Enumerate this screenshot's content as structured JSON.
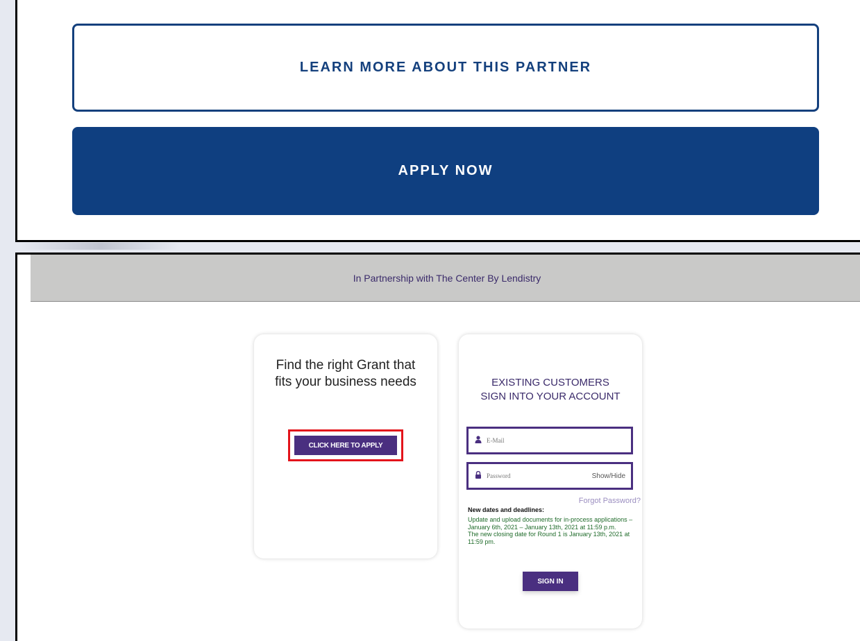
{
  "partner_panel": {
    "learn_more_label": "LEARN MORE ABOUT THIS PARTNER",
    "apply_now_label": "APPLY NOW"
  },
  "grant_page": {
    "header_text": "In Partnership with The Center By Lendistry",
    "left_card": {
      "heading_line1": "Find the right Grant that",
      "heading_line2": "fits your business needs",
      "apply_button_label": "CLICK HERE TO APPLY"
    },
    "signin_card": {
      "heading_line1": "EXISTING CUSTOMERS",
      "heading_line2": "SIGN INTO YOUR ACCOUNT",
      "email_placeholder": "E-Mail",
      "password_placeholder": "Password",
      "show_hide_label": "Show/Hide",
      "forgot_password_label": "Forgot Password?",
      "deadlines_title": "New dates and deadlines:",
      "deadline_line1": "Update and upload documents for in-process applications – January 6th, 2021 – January 13th, 2021 at 11:59 p.m.",
      "deadline_line2": "The new closing date for Round 1 is January 13th, 2021 at 11:59 pm.",
      "signin_button_label": "SIGN IN"
    }
  },
  "colors": {
    "brand_blue": "#0f3f80",
    "brand_purple": "#4a2f80",
    "highlight_red": "#e3141b",
    "deadline_green": "#1f6b2a"
  }
}
